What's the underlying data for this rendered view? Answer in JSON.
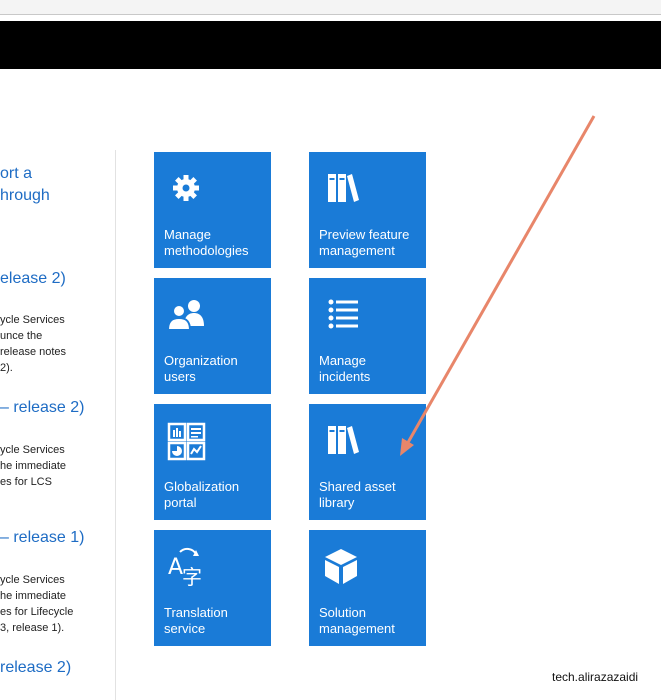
{
  "left_panel": {
    "links": [
      "ort a",
      "hrough",
      "elease 2)",
      "– release 2)",
      "– release 1)",
      "release 2)"
    ],
    "note1": [
      "ycle Services",
      "unce the",
      "release notes",
      "2)."
    ],
    "note2": [
      "ycle Services",
      "he immediate",
      "es for LCS"
    ],
    "note3": [
      "ycle Services",
      "he immediate",
      "es for Lifecycle",
      "3, release 1)."
    ]
  },
  "tiles": [
    {
      "icon": "gear-icon",
      "lines": [
        "Manage",
        "methodologies"
      ]
    },
    {
      "icon": "books-icon",
      "lines": [
        "Preview feature",
        "management"
      ]
    },
    {
      "icon": "users-icon",
      "lines": [
        "Organization",
        "users"
      ]
    },
    {
      "icon": "list-icon",
      "lines": [
        "Manage",
        "incidents"
      ]
    },
    {
      "icon": "globalization-icon",
      "lines": [
        "Globalization",
        "portal"
      ]
    },
    {
      "icon": "books-icon",
      "lines": [
        "Shared asset",
        "library"
      ]
    },
    {
      "icon": "translate-icon",
      "lines": [
        "Translation",
        "service"
      ]
    },
    {
      "icon": "package-icon",
      "lines": [
        "Solution",
        "management"
      ]
    }
  ],
  "watermark": "tech.alirazazaidi",
  "colors": {
    "tile": "#1a7bd7",
    "link": "#1e6cc4",
    "arrow": "#e8866a"
  }
}
